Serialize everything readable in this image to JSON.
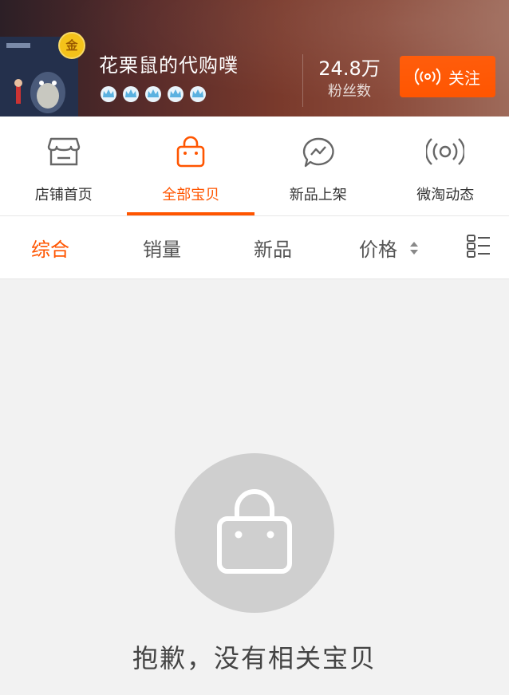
{
  "header": {
    "shop_name": "花栗鼠的代购噗",
    "badge": "金",
    "fans_count": "24.8万",
    "fans_label": "粉丝数",
    "follow_label": "关注",
    "crown_count": 5,
    "follow_color": "#ff5500"
  },
  "tabs": [
    {
      "label": "店铺首页",
      "icon": "store-icon",
      "active": false
    },
    {
      "label": "全部宝贝",
      "icon": "bag-icon",
      "active": true
    },
    {
      "label": "新品上架",
      "icon": "new-arrival-icon",
      "active": false
    },
    {
      "label": "微淘动态",
      "icon": "broadcast-icon",
      "active": false
    }
  ],
  "sort": {
    "items": [
      {
        "label": "综合",
        "active": true
      },
      {
        "label": "销量",
        "active": false
      },
      {
        "label": "新品",
        "active": false
      },
      {
        "label": "价格",
        "active": false
      }
    ],
    "layout_icon": "list-view-icon"
  },
  "empty": {
    "message": "抱歉，没有相关宝贝",
    "icon": "bag-icon"
  },
  "colors": {
    "accent": "#ff5500",
    "background": "#f2f2f2"
  }
}
